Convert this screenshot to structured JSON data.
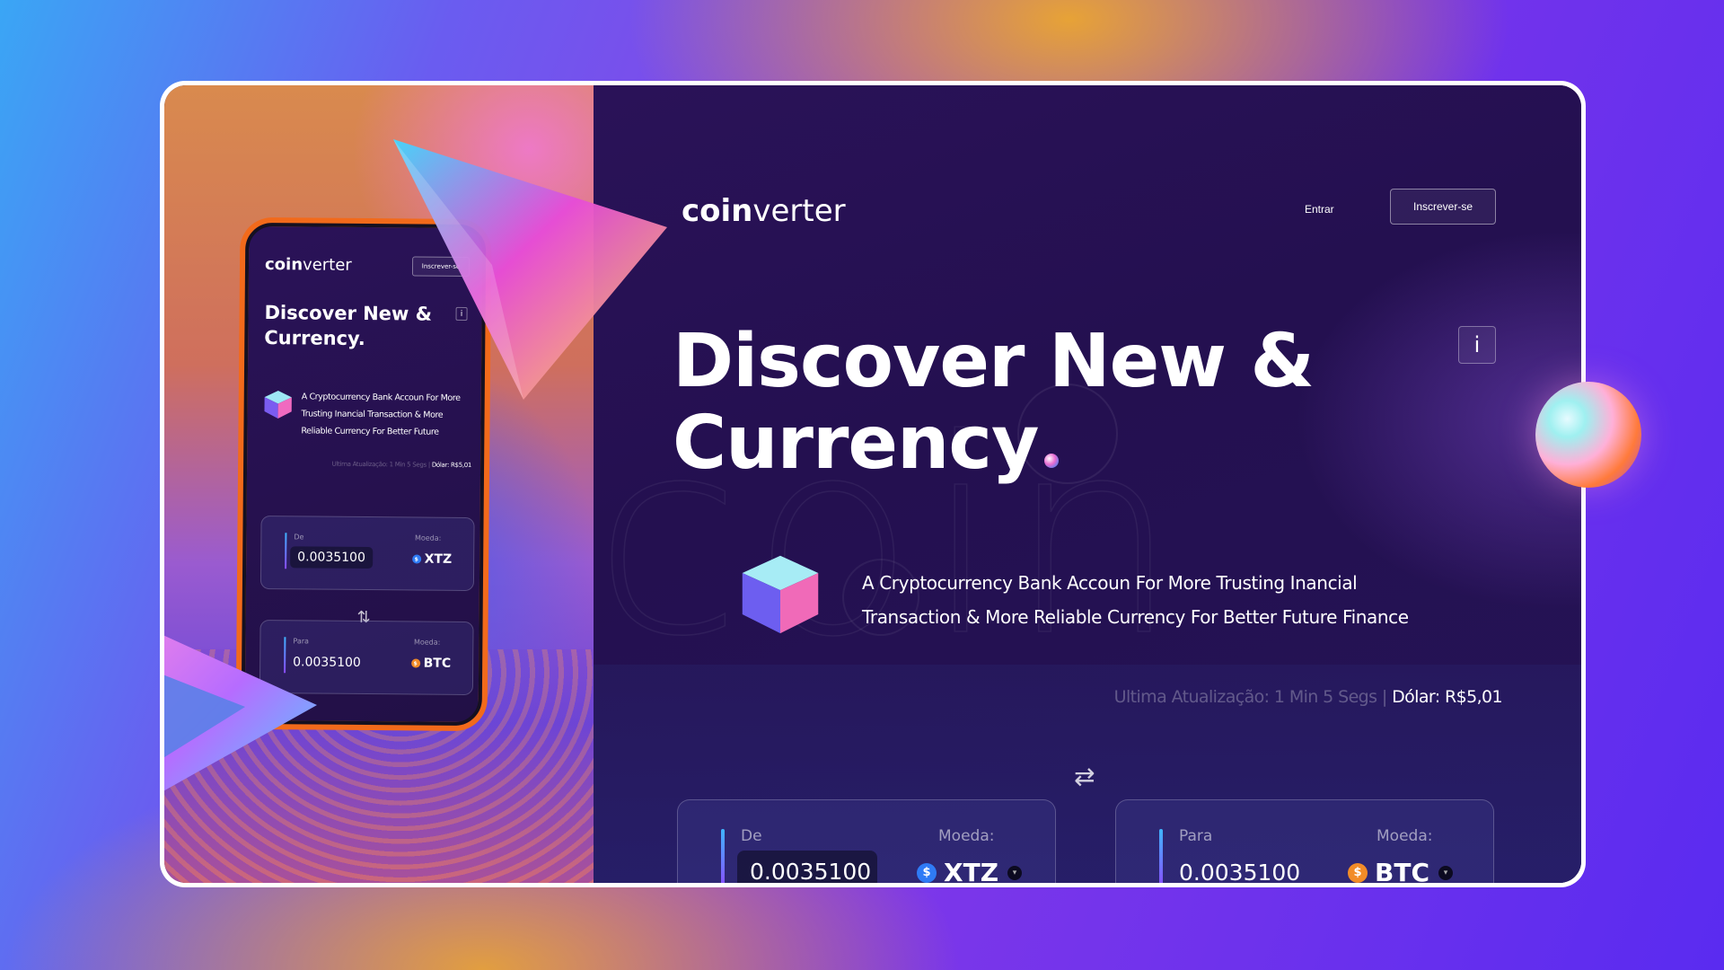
{
  "brand": {
    "logo_bold": "coin",
    "logo_light": "verter"
  },
  "nav": {
    "login_label": "Entrar",
    "signup_label": "Inscrever-se"
  },
  "hero": {
    "title_line1": "Discover New &",
    "title_line2": "Currency",
    "info_label": "i",
    "description": "A Cryptocurrency Bank Accoun For More Trusting Inancial Transaction & More Reliable Currency For Better Future Finance",
    "background_word": "coin"
  },
  "status": {
    "update_text": "Ultima Atualização: 1 Min 5 Segs | ",
    "dollar_text": "Dólar: R$5,01"
  },
  "converter": {
    "from": {
      "label": "De",
      "coin_label": "Moeda:",
      "value": "0.0035100",
      "coin": "XTZ",
      "coin_symbol": "$",
      "coin_color": "#2f7bf5"
    },
    "to": {
      "label": "Para",
      "coin_label": "Moeda:",
      "value": "0.0035100",
      "coin": "BTC",
      "coin_symbol": "$",
      "coin_color": "#f28c28"
    },
    "swap_icon": "⇄"
  },
  "phone": {
    "logo_bold": "coin",
    "logo_light": "verter",
    "signup_label": "Inscrever-se",
    "title_line1": "Discover New &",
    "title_line2": "Currency.",
    "info_label": "i",
    "description": "A Cryptocurrency Bank Accoun For More Trusting Inancial Transaction & More Reliable Currency For Better Future",
    "status_text": "Ultima Atualização: 1 Min 5 Segs | ",
    "dollar_text": "Dólar: R$5,01",
    "from": {
      "label": "De",
      "coin_label": "Moeda:",
      "value": "0.0035100",
      "coin": "XTZ"
    },
    "to": {
      "label": "Para",
      "coin_label": "Moeda:",
      "value": "0.0035100",
      "coin": "BTC"
    },
    "swap_icon": "⇅"
  },
  "colors": {
    "accent_blue": "#3fb5ff",
    "accent_purple": "#8b4bff",
    "bg_dark": "#241050",
    "phone_frame": "#f26a1b"
  }
}
